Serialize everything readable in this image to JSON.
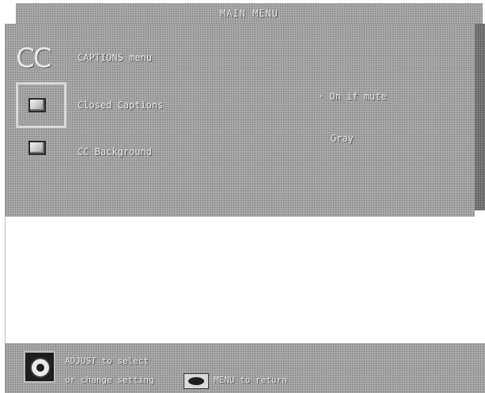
{
  "header": {
    "title": "MAIN MENU"
  },
  "menu": {
    "logo_text": "CC",
    "heading": "CAPTIONS menu",
    "items": [
      {
        "label": "Closed Captions",
        "value": "On if mute"
      },
      {
        "label": "CC Background",
        "value": "Gray"
      }
    ]
  },
  "footer": {
    "select_hint": "ADJUST to select",
    "change_hint": "or change setting",
    "return_hint": "MENU to return"
  }
}
